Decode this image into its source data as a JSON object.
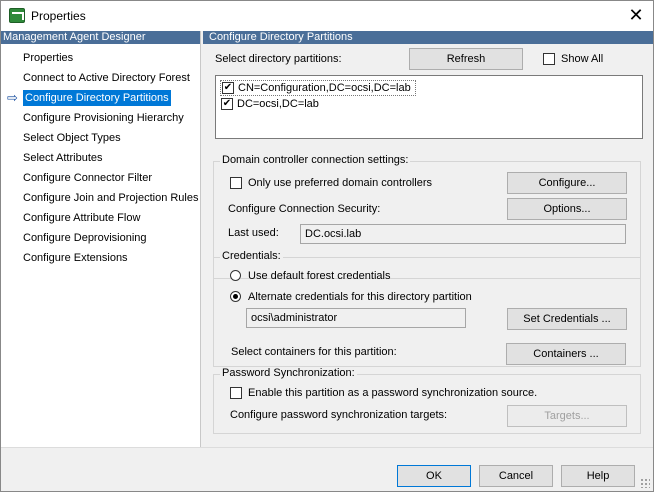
{
  "window": {
    "title": "Properties",
    "close_glyph": "✕"
  },
  "left_pane": {
    "header": "Management Agent Designer",
    "items": [
      {
        "label": "Properties"
      },
      {
        "label": "Connect to Active Directory Forest"
      },
      {
        "label": "Configure Directory Partitions",
        "selected": true
      },
      {
        "label": "Configure Provisioning Hierarchy"
      },
      {
        "label": "Select Object Types"
      },
      {
        "label": "Select Attributes"
      },
      {
        "label": "Configure Connector Filter"
      },
      {
        "label": "Configure Join and Projection Rules"
      },
      {
        "label": "Configure Attribute Flow"
      },
      {
        "label": "Configure Deprovisioning"
      },
      {
        "label": "Configure Extensions"
      }
    ],
    "arrow_glyph": "⇨"
  },
  "right_pane": {
    "header": "Configure Directory Partitions",
    "select_partitions_label": "Select directory partitions:",
    "refresh_label": "Refresh",
    "show_all_label": "Show All",
    "show_all_checked": false,
    "partitions": [
      {
        "name": "CN=Configuration,DC=ocsi,DC=lab",
        "checked": true
      },
      {
        "name": "DC=ocsi,DC=lab",
        "checked": true
      }
    ],
    "dc_settings": {
      "title": "Domain controller connection settings:",
      "preferred_label": "Only use preferred domain controllers",
      "preferred_checked": false,
      "configure_label": "Configure...",
      "security_label": "Configure Connection Security:",
      "options_label": "Options...",
      "last_used_label": "Last used:",
      "last_used_value": "DC.ocsi.lab"
    },
    "credentials": {
      "title": "Credentials:",
      "default_label": "Use default forest credentials",
      "alternate_label": "Alternate credentials for this directory partition",
      "selected": "alternate",
      "account_value": "ocsi\\administrator",
      "set_credentials_label": "Set Credentials ..."
    },
    "containers": {
      "label": "Select containers for this partition:",
      "button_label": "Containers ..."
    },
    "password_sync": {
      "title": "Password Synchronization:",
      "enable_label": "Enable this partition as a password synchronization source.",
      "enable_checked": false,
      "targets_label": "Configure password synchronization targets:",
      "targets_button": "Targets..."
    }
  },
  "footer": {
    "ok_label": "OK",
    "cancel_label": "Cancel",
    "help_label": "Help"
  },
  "colors": {
    "header_bg": "#4a6e98",
    "selection": "#0078d7"
  }
}
